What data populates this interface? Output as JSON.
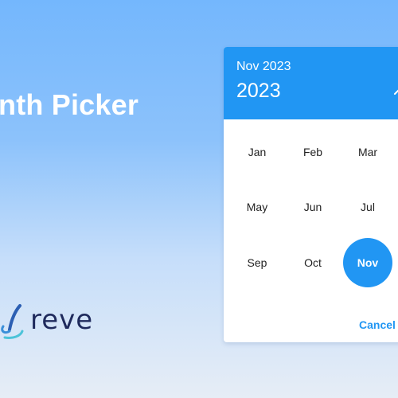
{
  "page": {
    "title": "Month Picker",
    "title_visible": "nth Picker",
    "logo_text": "reve"
  },
  "picker": {
    "selected_label": "Nov 2023",
    "year_label": "2023",
    "chevron_icon": "chevron-up-icon",
    "months": [
      "Jan",
      "Feb",
      "Mar",
      "May",
      "Jun",
      "Jul",
      "Sep",
      "Oct",
      "Nov"
    ],
    "selected_month": "Nov",
    "cancel_label": "Cancel",
    "accent_color": "#2196f3"
  }
}
